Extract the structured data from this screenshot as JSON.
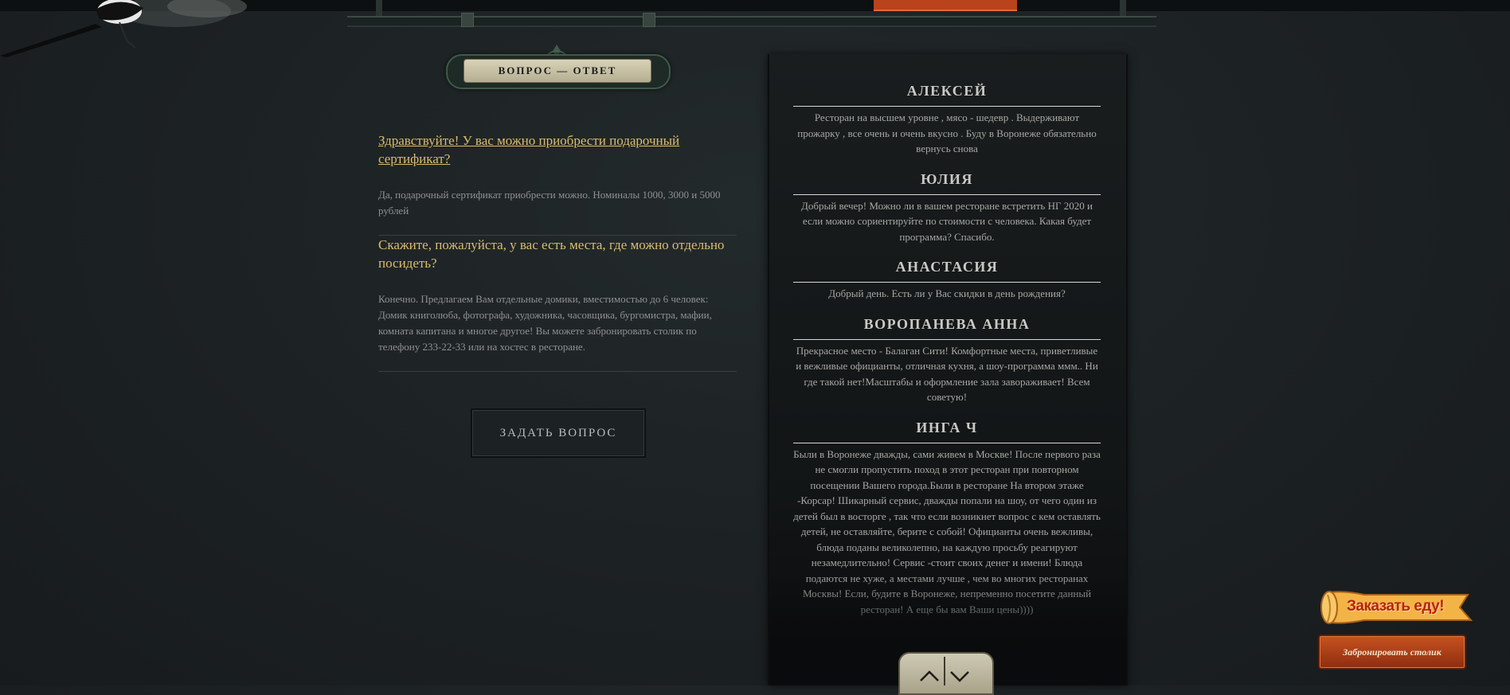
{
  "qa": {
    "badge_label": "ВОПРОС — ОТВЕТ",
    "items": [
      {
        "question": "Здравствуйте! У вас можно приобрести подарочный сертификат?",
        "answer": "Да, подарочный сертификат приобрести можно. Номиналы 1000, 3000 и 5000 рублей"
      },
      {
        "question": "Скажите, пожалуйста, у вас есть места, где можно отдельно посидеть?",
        "answer": "Конечно. Предлагаем Вам отдельные домики, вместимостью до 6 человек: Домик книголюба, фотографа, художника, часовщика, бургомистра, мафии, комната капитана и многое другое! Вы можете забронировать столик по телефону 233-22-33 или на хостес в ресторане."
      }
    ],
    "ask_button": "ЗАДАТЬ ВОПРОС"
  },
  "reviews": [
    {
      "name": "АЛЕКСЕЙ",
      "text": "Ресторан на высшем уровне , мясо - шедевр . Выдерживают прожарку , все очень и очень вкусно . Буду в Воронеже обязательно вернусь снова"
    },
    {
      "name": "ЮЛИЯ",
      "text": "Добрый вечер! Можно ли в вашем ресторане встретить НГ 2020 и если можно сориентируйте по стоимости с человека. Какая будет программа? Спасибо."
    },
    {
      "name": "АНАСТАСИЯ",
      "text": "Добрый день. Есть ли у Вас скидки в день рождения?"
    },
    {
      "name": "ВОРОПАНЕВА АННА",
      "text": "Прекрасное место - Балаган Сити! Комфортные места, приветливые и вежливые официанты, отличная кухня, а шоу-программа ммм.. Ни где такой нет!Масштабы и оформление зала завораживает! Всем советую!"
    },
    {
      "name": "ИНГА Ч",
      "text": "Были в Воронеже дважды, сами живем в Москве! После первого раза не смогли пропустить поход в этот ресторан при повторном посещении Вашего города.Были в ресторане На втором этаже -Корсар! Шикарный сервис, дважды попали на шоу, от чего один из детей был в восторге , так что если возникнет вопрос с кем оставлять детей, не оставляйте, берите с собой! Официанты очень вежливы, блюда поданы великолепно, на каждую просьбу реагируют незамедлительно! Сервис -стоит своих денег и имени! Блюда подаются не хуже, а местами лучше , чем во многих ресторанах Москвы! Если, будите в Воронеже, непременно посетите данный ресторан! А еще бы вам Ваши цены))))"
    }
  ],
  "order_widget": {
    "title": "Заказать еду!",
    "button": "Забронировать столик"
  },
  "icons": {
    "scroll_up": "chevron-up-icon",
    "scroll_down": "chevron-down-icon"
  },
  "colors": {
    "background": "#1d2224",
    "question": "#d9bd6c",
    "accent_orange": "#b8431c"
  }
}
